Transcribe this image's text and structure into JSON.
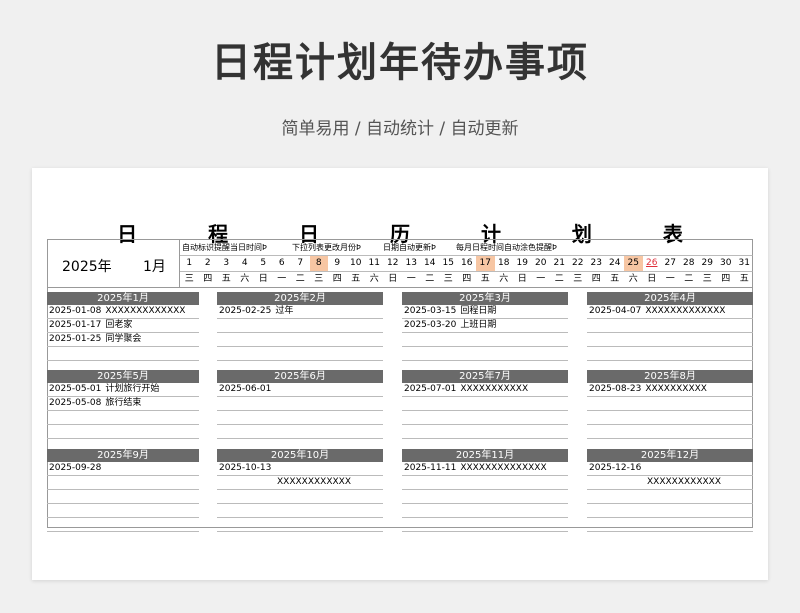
{
  "header": {
    "title": "日程计划年待办事项",
    "subtitle": "简单易用 / 自动统计 / 自动更新"
  },
  "calendar": {
    "title": "日 程 日 历 计 划 表",
    "year": "2025年",
    "month": "1月",
    "notes": [
      "自动标识提醒当日时间Þ",
      "下拉列表更改月份Þ",
      "日期自动更新Þ",
      "每月日程时间自动涂色提醒Þ"
    ],
    "days": [
      "1",
      "2",
      "3",
      "4",
      "5",
      "6",
      "7",
      "8",
      "9",
      "10",
      "11",
      "12",
      "13",
      "14",
      "15",
      "16",
      "17",
      "18",
      "19",
      "20",
      "21",
      "22",
      "23",
      "24",
      "25",
      "26",
      "27",
      "28",
      "29",
      "30",
      "31"
    ],
    "weekdays": [
      "三",
      "四",
      "五",
      "六",
      "日",
      "一",
      "二",
      "三",
      "四",
      "五",
      "六",
      "日",
      "一",
      "二",
      "三",
      "四",
      "五",
      "六",
      "日",
      "一",
      "二",
      "三",
      "四",
      "五",
      "六",
      "日",
      "一",
      "二",
      "三",
      "四",
      "五"
    ],
    "highlight_days": [
      "8",
      "17",
      "25"
    ],
    "red_day": "26",
    "highlight_color": "#f7c6a3",
    "red_color": "#e0303a",
    "header_bar_color": "#6a6a6a"
  },
  "months": [
    {
      "label": "2025年1月",
      "entries": [
        {
          "date": "2025-01-08",
          "text": "XXXXXXXXXXXXX"
        },
        {
          "date": "2025-01-17",
          "text": "回老家"
        },
        {
          "date": "2025-01-25",
          "text": "同学聚会"
        }
      ]
    },
    {
      "label": "2025年2月",
      "entries": [
        {
          "date": "2025-02-25",
          "text": "过年"
        }
      ]
    },
    {
      "label": "2025年3月",
      "entries": [
        {
          "date": "2025-03-15",
          "text": "回程日期"
        },
        {
          "date": "2025-03-20",
          "text": "上班日期"
        }
      ]
    },
    {
      "label": "2025年4月",
      "entries": [
        {
          "date": "2025-04-07",
          "text": "XXXXXXXXXXXXX"
        }
      ]
    },
    {
      "label": "2025年5月",
      "entries": [
        {
          "date": "2025-05-01",
          "text": "计划旅行开始"
        },
        {
          "date": "2025-05-08",
          "text": "旅行结束"
        }
      ]
    },
    {
      "label": "2025年6月",
      "entries": [
        {
          "date": "2025-06-01",
          "text": ""
        }
      ]
    },
    {
      "label": "2025年7月",
      "entries": [
        {
          "date": "2025-07-01",
          "text": "XXXXXXXXXXX"
        }
      ]
    },
    {
      "label": "2025年8月",
      "entries": [
        {
          "date": "2025-08-23",
          "text": "XXXXXXXXXX"
        }
      ]
    },
    {
      "label": "2025年9月",
      "entries": [
        {
          "date": "2025-09-28",
          "text": ""
        }
      ]
    },
    {
      "label": "2025年10月",
      "entries": [
        {
          "date": "2025-10-13",
          "text": ""
        },
        {
          "date": "",
          "text": "XXXXXXXXXXXX"
        }
      ]
    },
    {
      "label": "2025年11月",
      "entries": [
        {
          "date": "2025-11-11",
          "text": "XXXXXXXXXXXXXX"
        }
      ]
    },
    {
      "label": "2025年12月",
      "entries": [
        {
          "date": "2025-12-16",
          "text": ""
        },
        {
          "date": "",
          "text": "XXXXXXXXXXXX"
        }
      ]
    }
  ]
}
